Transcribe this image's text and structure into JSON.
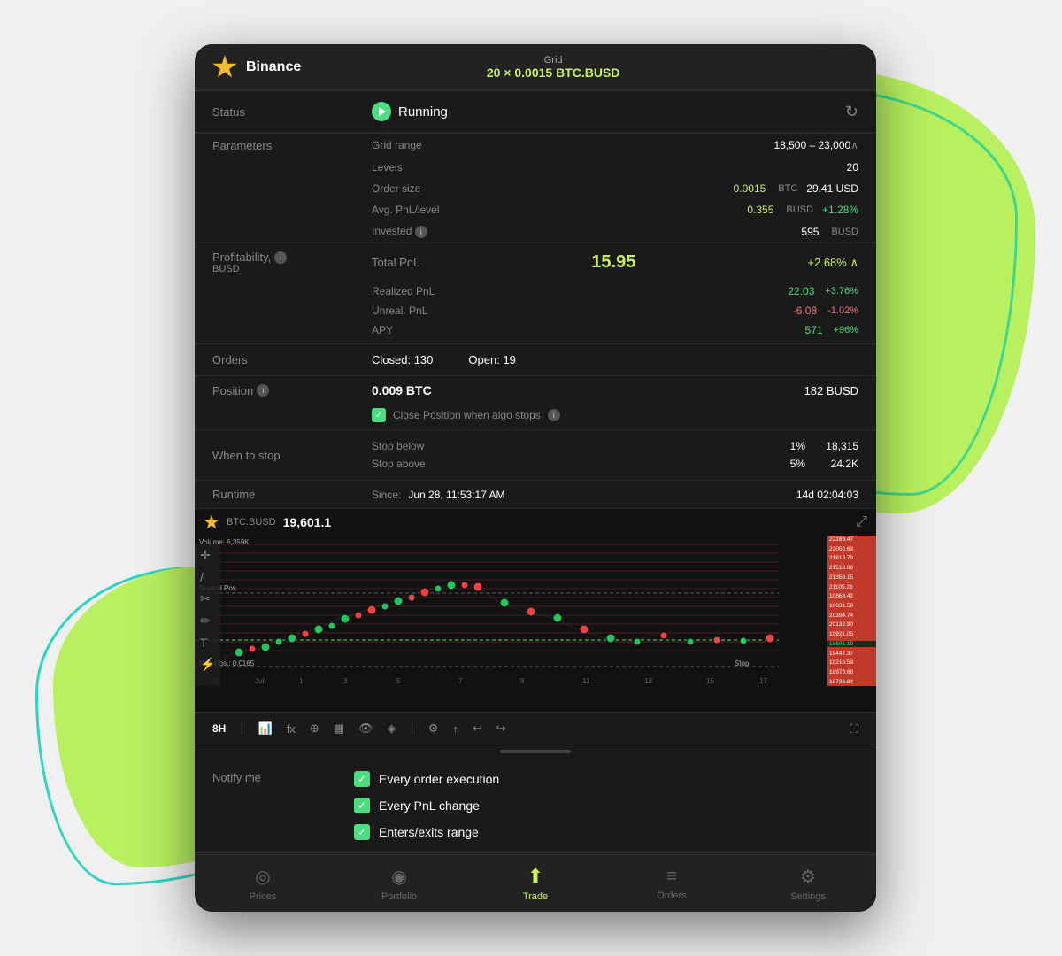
{
  "background": {
    "blob_colors": [
      "#b8f060",
      "#3dd68c",
      "#2dd4bf"
    ]
  },
  "header": {
    "brand": "Binance",
    "grid_label": "Grid",
    "grid_value": "20 × 0.0015 BTC.BUSD"
  },
  "status": {
    "label": "Status",
    "value": "Running",
    "refresh_icon": "↻"
  },
  "parameters": {
    "label": "Parameters",
    "grid_range_label": "Grid range",
    "grid_range_value": "18,500 – 23,000",
    "levels_label": "Levels",
    "levels_value": "20",
    "order_size_label": "Order size",
    "order_size_value": "0.0015",
    "order_size_unit": "BTC",
    "order_size_usd": "29.41 USD",
    "avg_pnl_label": "Avg. PnL/level",
    "avg_pnl_value": "0.355",
    "avg_pnl_unit": "BUSD",
    "avg_pnl_pct": "+1.28%",
    "invested_label": "Invested",
    "invested_value": "595",
    "invested_unit": "BUSD"
  },
  "profitability": {
    "label": "Profitability,",
    "sublabel": "BUSD",
    "total_pnl_label": "Total PnL",
    "total_pnl_value": "15.95",
    "total_pnl_pct": "+2.68%",
    "realized_label": "Realized PnL",
    "realized_value": "22.03",
    "realized_pct": "+3.76%",
    "unreal_label": "Unreal. PnL",
    "unreal_value": "-6.08",
    "unreal_pct": "-1.02%",
    "apy_label": "APY",
    "apy_value": "571",
    "apy_pct": "+96%"
  },
  "orders": {
    "label": "Orders",
    "closed_label": "Closed:",
    "closed_value": "130",
    "open_label": "Open:",
    "open_value": "19"
  },
  "position": {
    "label": "Position",
    "btc_value": "0.009 BTC",
    "busd_value": "182 BUSD",
    "close_text": "Close Position when algo stops"
  },
  "when_to_stop": {
    "label": "When to stop",
    "stop_below_label": "Stop below",
    "stop_below_pct": "1%",
    "stop_below_value": "18,315",
    "stop_above_label": "Stop above",
    "stop_above_pct": "5%",
    "stop_above_value": "24.2K"
  },
  "runtime": {
    "label": "Runtime",
    "since_label": "Since:",
    "since_value": "Jun 28, 11:53:17 AM",
    "elapsed": "14d 02:04:03"
  },
  "chart": {
    "symbol": "BTC.BUSD",
    "price": "19,601.1",
    "expand_icon": "⤢",
    "volume_label": "Volume: 6,359K",
    "neutral_pos_label": "Neutral Pos.",
    "max_pos_label": "Max Pos.: 0.0165",
    "current_price_line": "19601.10",
    "price_labels": [
      "22289.47",
      "22052.63",
      "21813.79",
      "21518.99",
      "21359.15",
      "21105.26",
      "10868.42",
      "10631.58",
      "20394.74",
      "20132.90",
      "19921.05",
      "19601.10",
      "19447.37",
      "19210.53",
      "18973.68",
      "18736.84"
    ],
    "date_labels": [
      "29",
      "Jul",
      "1",
      "3",
      "5",
      "7",
      "9",
      "11",
      "13",
      "15",
      "17"
    ]
  },
  "chart_toolbar": {
    "timeframe": "8H",
    "tools": [
      "indicators",
      "fx",
      "crosshair",
      "layout",
      "eye",
      "layers",
      "settings",
      "share",
      "undo",
      "redo"
    ],
    "fullscreen": "⛶"
  },
  "notify_me": {
    "label": "Notify me",
    "items": [
      {
        "text": "Every order execution",
        "checked": true
      },
      {
        "text": "Every PnL change",
        "checked": true
      },
      {
        "text": "Enters/exits range",
        "checked": true
      }
    ]
  },
  "bottom_nav": {
    "items": [
      {
        "label": "Prices",
        "icon": "◎",
        "active": false
      },
      {
        "label": "Portfolio",
        "icon": "◉",
        "active": false
      },
      {
        "label": "Trade",
        "icon": "⬆",
        "active": true
      },
      {
        "label": "Orders",
        "icon": "≡",
        "active": false
      },
      {
        "label": "Settings",
        "icon": "⚙",
        "active": false
      }
    ]
  }
}
